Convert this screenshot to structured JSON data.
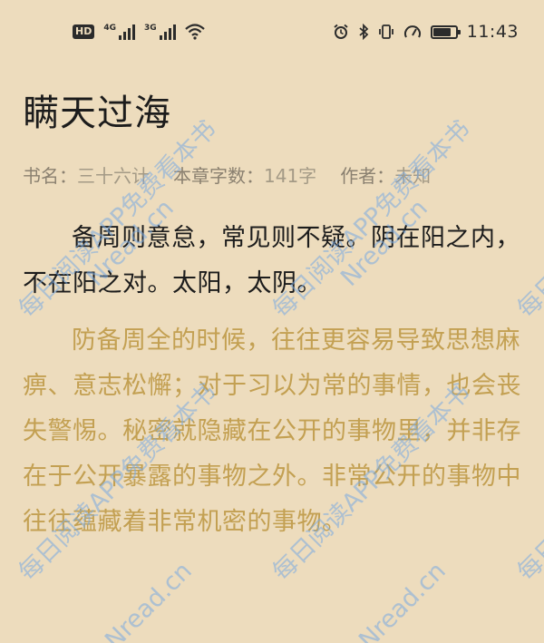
{
  "status_bar": {
    "hd_label": "HD",
    "sim1_label": "4G",
    "sim2_label": "3G",
    "time": "11:43",
    "icons": [
      "hd-icon",
      "signal-4g-icon",
      "signal-3g-icon",
      "wifi-icon",
      "alarm-icon",
      "bluetooth-icon",
      "vibrate-icon",
      "speed-icon",
      "battery-icon"
    ],
    "battery_level": 0.8
  },
  "chapter": {
    "title": "瞒天过海",
    "book_label": "书名：",
    "book_value": "三十六计",
    "wordcount_label": "本章字数：",
    "wordcount_value": "141字",
    "author_label": "作者：",
    "author_value": "未知"
  },
  "content": {
    "original": "备周则意怠，常见则不疑。阴在阳之内，不在阳之对。太阳，太阴。",
    "translation": "防备周全的时候，往往更容易导致思想麻痹、意志松懈；对于习以为常的事情，也会丧失警惕。秘密就隐藏在公开的事物里，并非存在于公开暴露的事物之外。非常公开的事物中往往蕴藏着非常机密的事物。"
  },
  "watermark": {
    "line1": "每日阅读APP免费看本书",
    "line2": "Nread.cn"
  },
  "colors": {
    "background": "#eddcbd",
    "title": "#1c1c1c",
    "translation": "#c3a052",
    "watermark": "#78aae1"
  }
}
